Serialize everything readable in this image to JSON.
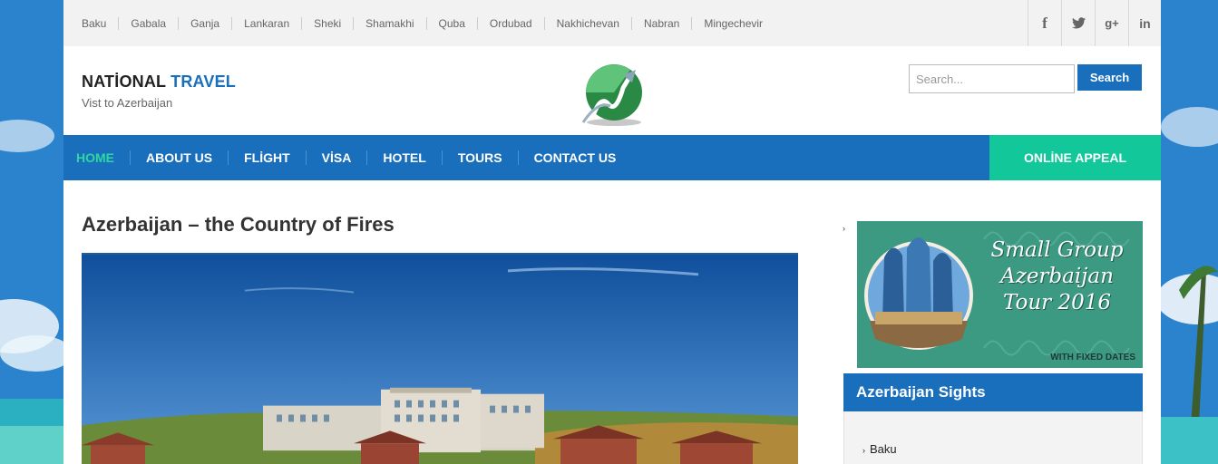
{
  "topbar": {
    "cities": [
      "Baku",
      "Gabala",
      "Ganja",
      "Lankaran",
      "Sheki",
      "Shamakhi",
      "Quba",
      "Ordubad",
      "Nakhichevan",
      "Nabran",
      "Mingechevir"
    ],
    "social_icons": [
      {
        "name": "facebook-icon",
        "glyph": "f"
      },
      {
        "name": "twitter-icon",
        "glyph": "🐦"
      },
      {
        "name": "google-plus-icon",
        "glyph": "g+"
      },
      {
        "name": "linkedin-icon",
        "glyph": "in"
      }
    ]
  },
  "header": {
    "brand_part1": "NATİONAL ",
    "brand_part2": "TRAVEL",
    "tagline": "Vist to Azerbaijan",
    "search_placeholder": "Search...",
    "search_button": "Search"
  },
  "nav": {
    "items": [
      "HOME",
      "ABOUT US",
      "FLİGHT",
      "VİSA",
      "HOTEL",
      "TOURS",
      "CONTACT US"
    ],
    "appeal": "ONLİNE APPEAL"
  },
  "main": {
    "post_title": "Azerbaijan – the Country of Fires"
  },
  "sidebar": {
    "banner_lines": [
      "Small Group",
      "Azerbaijan",
      "Tour 2016"
    ],
    "banner_footer": "WITH FIXED DATES",
    "sights_title": "Azerbaijan Sights",
    "sights": [
      "Baku"
    ]
  },
  "colors": {
    "brand_blue": "#1a6fbd",
    "accent_green": "#12c79a",
    "active_nav": "#2ed6a0"
  }
}
